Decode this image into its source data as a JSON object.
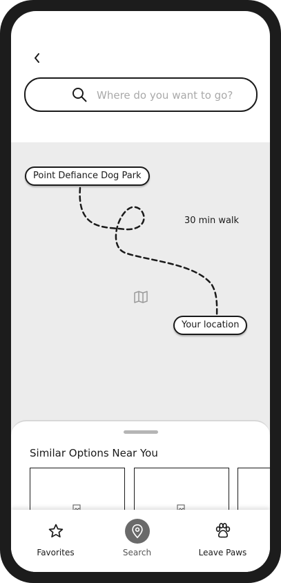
{
  "search": {
    "placeholder": "Where do you want to go?"
  },
  "map": {
    "destination_label": "Point Defiance Dog Park",
    "origin_label": "Your location",
    "travel_time": "30 min walk"
  },
  "sheet": {
    "title": "Similar Options Near You",
    "cards": [
      {},
      {},
      {}
    ]
  },
  "tabs": [
    {
      "label": "Favorites",
      "icon": "star-icon",
      "active": false
    },
    {
      "label": "Search",
      "icon": "location-pin-icon",
      "active": true
    },
    {
      "label": "Leave Paws",
      "icon": "paw-icon",
      "active": false
    }
  ],
  "colors": {
    "frame": "#1c1c1c",
    "map_bg": "#ececec",
    "active_tab": "#6a6a6a"
  }
}
